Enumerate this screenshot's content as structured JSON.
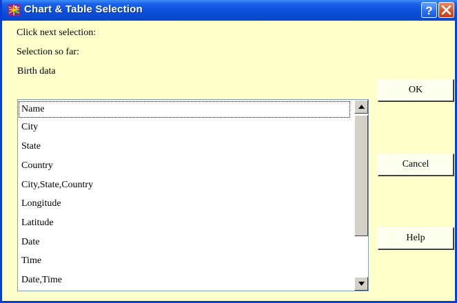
{
  "window": {
    "title": "Chart & Table Selection"
  },
  "titlebar": {
    "help_glyph": "?",
    "close_glyph": "X"
  },
  "labels": {
    "prompt": "Click next selection:",
    "so_far": "Selection so far:",
    "category": "Birth data"
  },
  "list": {
    "items": [
      "Name",
      "City",
      "State",
      "Country",
      "City,State,Country",
      "Longitude",
      "Latitude",
      "Date",
      "Time",
      "Date,Time"
    ]
  },
  "buttons": {
    "ok": "OK",
    "cancel": "Cancel",
    "help": "Help"
  },
  "colors": {
    "dialog_bg": "#ffffcc",
    "titlebar": "#0a4fd8",
    "close": "#d8512b"
  }
}
